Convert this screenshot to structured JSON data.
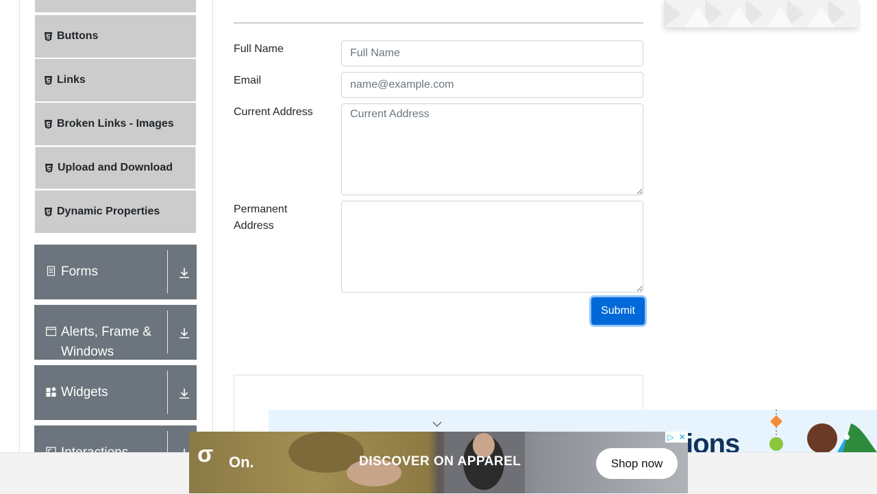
{
  "sidebar": {
    "elements_items": [
      {
        "label": "Buttons"
      },
      {
        "label": "Links"
      },
      {
        "label": "Broken Links - Images"
      },
      {
        "label": "Upload and Download"
      },
      {
        "label": "Dynamic Properties"
      }
    ],
    "groups": [
      {
        "label": "Forms",
        "icon": "document-icon"
      },
      {
        "label": "Alerts, Frame & Windows",
        "icon": "window-icon"
      },
      {
        "label": "Widgets",
        "icon": "widgets-icon"
      },
      {
        "label": "Interactions",
        "icon": "interactions-icon"
      }
    ]
  },
  "form": {
    "full_name": {
      "label": "Full Name",
      "placeholder": "Full Name",
      "value": ""
    },
    "email": {
      "label": "Email",
      "placeholder": "name@example.com",
      "value": ""
    },
    "current_address": {
      "label": "Current Address",
      "placeholder": "Current Address",
      "value": ""
    },
    "permanent_address": {
      "label": "Permanent Address",
      "placeholder": "",
      "value": ""
    },
    "submit_label": "Submit"
  },
  "ads": {
    "banner_text": "ions",
    "on_logo": "σ",
    "on_brand": "On.",
    "on_headline": "DISCOVER ON APPAREL",
    "on_cta": "Shop now",
    "adchoices": "▷",
    "close": "✕"
  },
  "colors": {
    "sidebar_item_bg": "#cccccc",
    "group_bg": "#6c757d",
    "submit_bg": "#0069d9"
  }
}
